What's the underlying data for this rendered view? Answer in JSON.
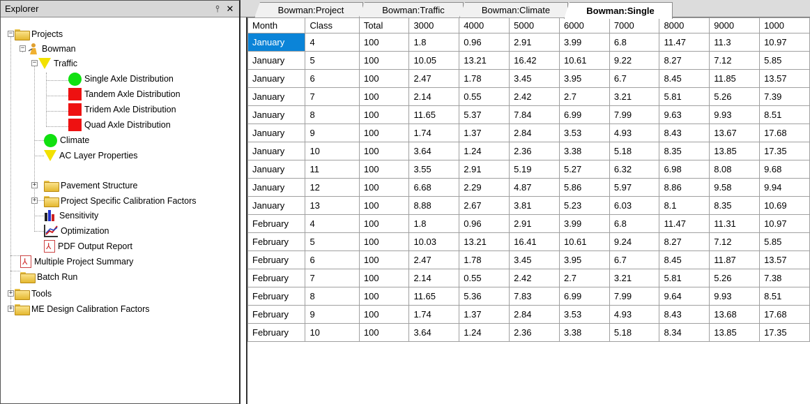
{
  "explorer": {
    "title": "Explorer",
    "pin_glyph": "📌",
    "close_glyph": "✕",
    "tree": [
      {
        "label": "Projects",
        "icon": "folder-icon"
      },
      {
        "label": "Bowman",
        "icon": "person-icon"
      },
      {
        "label": "Traffic",
        "icon": "yellow-triangle-icon"
      },
      {
        "label": "Single Axle Distribution",
        "icon": "green-circle-icon"
      },
      {
        "label": "Tandem Axle Distribution",
        "icon": "red-square-icon"
      },
      {
        "label": "Tridem Axle Distribution",
        "icon": "red-square-icon"
      },
      {
        "label": "Quad Axle Distribution",
        "icon": "red-square-icon"
      },
      {
        "label": "Climate",
        "icon": "green-circle-icon"
      },
      {
        "label": "AC Layer Properties",
        "icon": "yellow-triangle-icon"
      },
      {
        "label": "Pavement Structure",
        "icon": "folder-icon"
      },
      {
        "label": "Project Specific Calibration Factors",
        "icon": "folder-icon"
      },
      {
        "label": "Sensitivity",
        "icon": "bar-chart-icon"
      },
      {
        "label": "Optimization",
        "icon": "line-chart-icon"
      },
      {
        "label": "PDF Output Report",
        "icon": "pdf-icon"
      },
      {
        "label": "Multiple Project Summary",
        "icon": "pdf-icon"
      },
      {
        "label": "Batch Run",
        "icon": "folder-icon"
      },
      {
        "label": "Tools",
        "icon": "folder-icon"
      },
      {
        "label": "ME Design Calibration Factors",
        "icon": "folder-icon"
      }
    ]
  },
  "tabs": [
    {
      "label": "Bowman:Project",
      "active": false
    },
    {
      "label": "Bowman:Traffic",
      "active": false
    },
    {
      "label": "Bowman:Climate",
      "active": false
    },
    {
      "label": "Bowman:Single",
      "active": true
    }
  ],
  "grid": {
    "columns": [
      "Month",
      "Class",
      "Total",
      "3000",
      "4000",
      "5000",
      "6000",
      "7000",
      "8000",
      "9000",
      "1000"
    ],
    "rows": [
      [
        "January",
        "4",
        "100",
        "1.8",
        "0.96",
        "2.91",
        "3.99",
        "6.8",
        "11.47",
        "11.3",
        "10.97"
      ],
      [
        "January",
        "5",
        "100",
        "10.05",
        "13.21",
        "16.42",
        "10.61",
        "9.22",
        "8.27",
        "7.12",
        "5.85"
      ],
      [
        "January",
        "6",
        "100",
        "2.47",
        "1.78",
        "3.45",
        "3.95",
        "6.7",
        "8.45",
        "11.85",
        "13.57"
      ],
      [
        "January",
        "7",
        "100",
        "2.14",
        "0.55",
        "2.42",
        "2.7",
        "3.21",
        "5.81",
        "5.26",
        "7.39"
      ],
      [
        "January",
        "8",
        "100",
        "11.65",
        "5.37",
        "7.84",
        "6.99",
        "7.99",
        "9.63",
        "9.93",
        "8.51"
      ],
      [
        "January",
        "9",
        "100",
        "1.74",
        "1.37",
        "2.84",
        "3.53",
        "4.93",
        "8.43",
        "13.67",
        "17.68"
      ],
      [
        "January",
        "10",
        "100",
        "3.64",
        "1.24",
        "2.36",
        "3.38",
        "5.18",
        "8.35",
        "13.85",
        "17.35"
      ],
      [
        "January",
        "11",
        "100",
        "3.55",
        "2.91",
        "5.19",
        "5.27",
        "6.32",
        "6.98",
        "8.08",
        "9.68"
      ],
      [
        "January",
        "12",
        "100",
        "6.68",
        "2.29",
        "4.87",
        "5.86",
        "5.97",
        "8.86",
        "9.58",
        "9.94"
      ],
      [
        "January",
        "13",
        "100",
        "8.88",
        "2.67",
        "3.81",
        "5.23",
        "6.03",
        "8.1",
        "8.35",
        "10.69"
      ],
      [
        "February",
        "4",
        "100",
        "1.8",
        "0.96",
        "2.91",
        "3.99",
        "6.8",
        "11.47",
        "11.31",
        "10.97"
      ],
      [
        "February",
        "5",
        "100",
        "10.03",
        "13.21",
        "16.41",
        "10.61",
        "9.24",
        "8.27",
        "7.12",
        "5.85"
      ],
      [
        "February",
        "6",
        "100",
        "2.47",
        "1.78",
        "3.45",
        "3.95",
        "6.7",
        "8.45",
        "11.87",
        "13.57"
      ],
      [
        "February",
        "7",
        "100",
        "2.14",
        "0.55",
        "2.42",
        "2.7",
        "3.21",
        "5.81",
        "5.26",
        "7.38"
      ],
      [
        "February",
        "8",
        "100",
        "11.65",
        "5.36",
        "7.83",
        "6.99",
        "7.99",
        "9.64",
        "9.93",
        "8.51"
      ],
      [
        "February",
        "9",
        "100",
        "1.74",
        "1.37",
        "2.84",
        "3.53",
        "4.93",
        "8.43",
        "13.68",
        "17.68"
      ],
      [
        "February",
        "10",
        "100",
        "3.64",
        "1.24",
        "2.36",
        "3.38",
        "5.18",
        "8.34",
        "13.85",
        "17.35"
      ]
    ],
    "selected_cell": {
      "row": 0,
      "col": 0
    },
    "selection_color": "#0b84d8"
  }
}
